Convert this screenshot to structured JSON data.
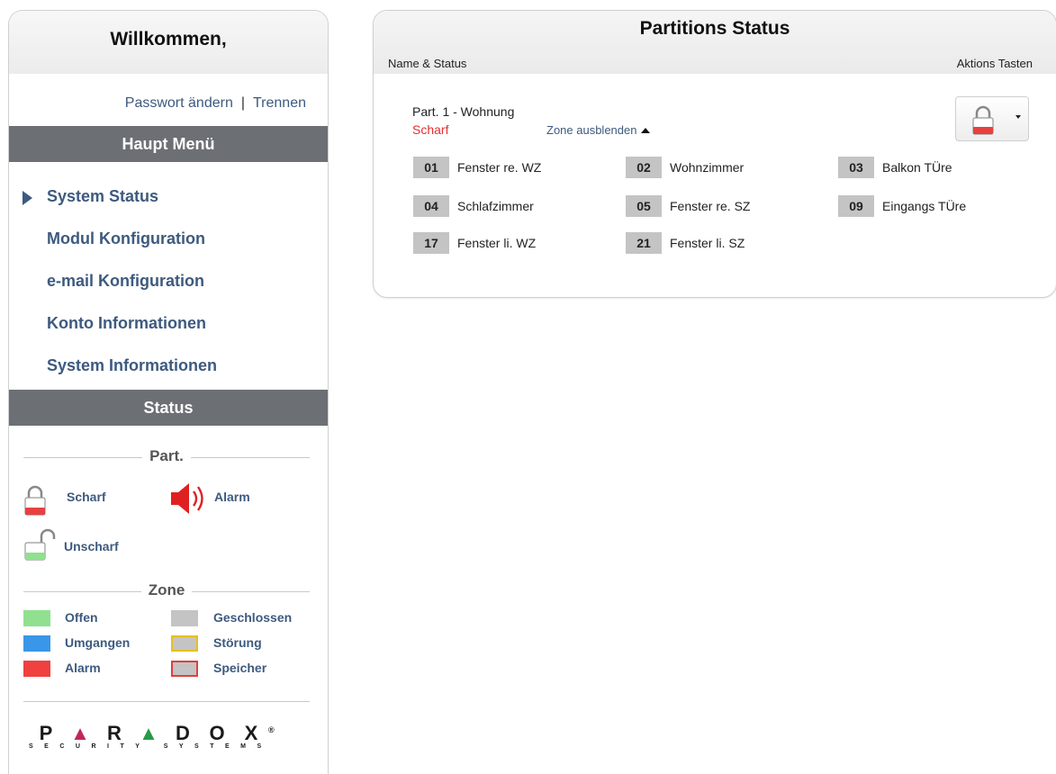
{
  "sidebar": {
    "welcome": "Willkommen,",
    "links": {
      "change_password": "Passwort ändern",
      "separator": "|",
      "logout": "Trennen"
    },
    "main_menu_header": "Haupt Menü",
    "menu_items": [
      {
        "label": "System Status",
        "active": true
      },
      {
        "label": "Modul Konfiguration"
      },
      {
        "label": "e-mail Konfiguration"
      },
      {
        "label": "Konto Informationen"
      },
      {
        "label": "System Informationen"
      }
    ],
    "status_header": "Status",
    "legend": {
      "part_title": "Part.",
      "armed": "Scharf",
      "alarm": "Alarm",
      "disarmed": "Unscharf",
      "zone_title": "Zone",
      "zones": {
        "open": {
          "label": "Offen",
          "color": "#90e090"
        },
        "bypassed": {
          "label": "Umgangen",
          "color": "#3a96e8"
        },
        "alarm": {
          "label": "Alarm",
          "color": "#f04040"
        },
        "closed": {
          "label": "Geschlossen",
          "color": "#c4c4c4"
        },
        "trouble": {
          "label": "Störung",
          "color": "#c4c4c4",
          "border": "#e8c020"
        },
        "memory": {
          "label": "Speicher",
          "color": "#c4c4c4",
          "border": "#e04040"
        }
      }
    },
    "logo": {
      "letters": [
        "P",
        "▲",
        "R",
        "▲",
        "D",
        "O",
        "X"
      ],
      "registered": "®",
      "tagline": "SECURITY SYSTEMS"
    }
  },
  "panel": {
    "title": "Partitions Status",
    "col_name_status": "Name & Status",
    "col_actions": "Aktions Tasten",
    "partition": {
      "name": "Part. 1 - Wohnung",
      "state": "Scharf",
      "zone_toggle": "Zone ausblenden",
      "action_icon": "lock-armed-icon"
    },
    "zones": [
      {
        "num": "01",
        "name": "Fenster re. WZ"
      },
      {
        "num": "02",
        "name": "Wohnzimmer"
      },
      {
        "num": "03",
        "name": "Balkon TÜre"
      },
      {
        "num": "04",
        "name": "Schlafzimmer"
      },
      {
        "num": "05",
        "name": "Fenster re. SZ"
      },
      {
        "num": "09",
        "name": "Eingangs TÜre"
      },
      {
        "num": "17",
        "name": "Fenster li. WZ"
      },
      {
        "num": "21",
        "name": "Fenster li. SZ"
      }
    ]
  },
  "colors": {
    "accent": "#3d5a7f",
    "header_bar": "#6c6f74",
    "armed": "#e03030",
    "alarm_icon": "#e02020"
  }
}
